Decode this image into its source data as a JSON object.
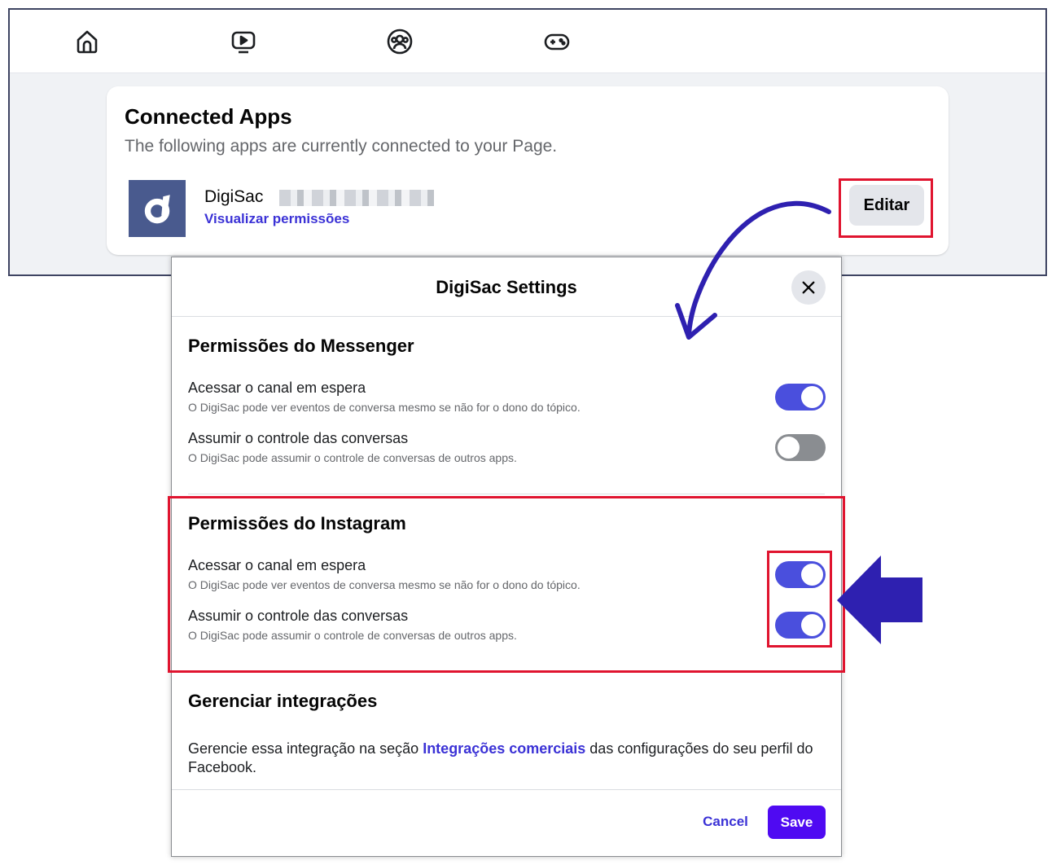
{
  "nav": {
    "icons": [
      "home-icon",
      "video-icon",
      "groups-icon",
      "gaming-icon"
    ]
  },
  "connected_apps": {
    "title": "Connected Apps",
    "subtitle": "The following apps are currently connected to your Page.",
    "app": {
      "name": "DigiSac",
      "permissions_link": "Visualizar permissões",
      "edit_label": "Editar"
    }
  },
  "modal": {
    "title": "DigiSac Settings",
    "messenger": {
      "title": "Permissões do Messenger",
      "options": [
        {
          "label": "Acessar o canal em espera",
          "desc": "O DigiSac pode ver eventos de conversa mesmo se não for o dono do tópico.",
          "enabled": true
        },
        {
          "label": "Assumir o controle das conversas",
          "desc": "O DigiSac pode assumir o controle de conversas de outros apps.",
          "enabled": false
        }
      ]
    },
    "instagram": {
      "title": "Permissões do Instagram",
      "options": [
        {
          "label": "Acessar o canal em espera",
          "desc": "O DigiSac pode ver eventos de conversa mesmo se não for o dono do tópico.",
          "enabled": true
        },
        {
          "label": "Assumir o controle das conversas",
          "desc": "O DigiSac pode assumir o controle de conversas de outros apps.",
          "enabled": true
        }
      ]
    },
    "manage": {
      "title": "Gerenciar integrações",
      "text_before": "Gerencie essa integração na seção ",
      "link": "Integrações comerciais",
      "text_after": " das configurações do seu perfil do Facebook."
    },
    "cancel_label": "Cancel",
    "save_label": "Save"
  },
  "colors": {
    "accent": "#4a4fdd",
    "link": "#3b32d6",
    "save": "#4f0af2",
    "highlight": "#e0142f",
    "annotation": "#2e20b0"
  }
}
